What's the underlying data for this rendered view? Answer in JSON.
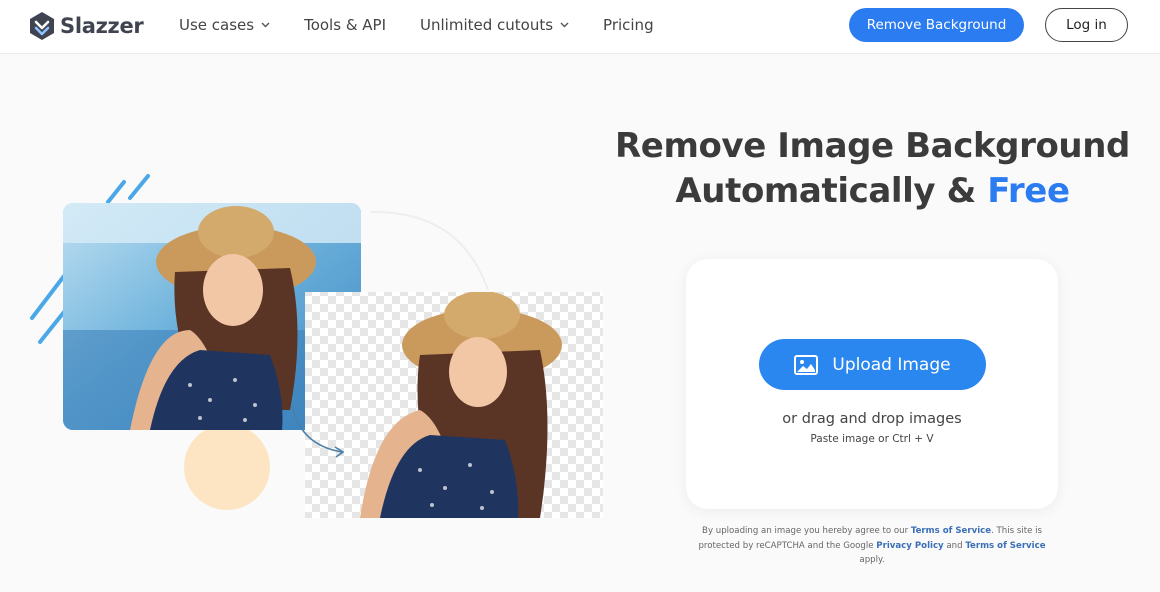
{
  "brand": {
    "name": "Slazzer",
    "logo_icon": "slazzer-logo-icon"
  },
  "nav": {
    "items": [
      {
        "label": "Use cases",
        "has_dropdown": true
      },
      {
        "label": "Tools & API",
        "has_dropdown": false
      },
      {
        "label": "Unlimited cutouts",
        "has_dropdown": true
      },
      {
        "label": "Pricing",
        "has_dropdown": false
      }
    ]
  },
  "header": {
    "remove_background_label": "Remove Background",
    "login_label": "Log in"
  },
  "hero": {
    "title_line1": "Remove Image Background",
    "title_line2_prefix": "Automatically &",
    "title_line2_accent": "Free"
  },
  "upload": {
    "button_label": "Upload Image",
    "button_icon": "image-icon",
    "drag_text": "or drag and drop images",
    "paste_text": "Paste image or Ctrl + V"
  },
  "legal": {
    "part1": "By uploading an image you hereby agree to our",
    "terms_link": "Terms of Service",
    "part2": ". This site is protected by reCAPTCHA and the Google",
    "privacy_link": "Privacy Policy",
    "part3": "and",
    "terms_link2": "Terms of Service",
    "part4": "apply."
  },
  "colors": {
    "accent": "#2b7cf0",
    "upload_button": "#2b87f0",
    "heading": "#3b3b3b",
    "link": "#3a6fb8"
  }
}
